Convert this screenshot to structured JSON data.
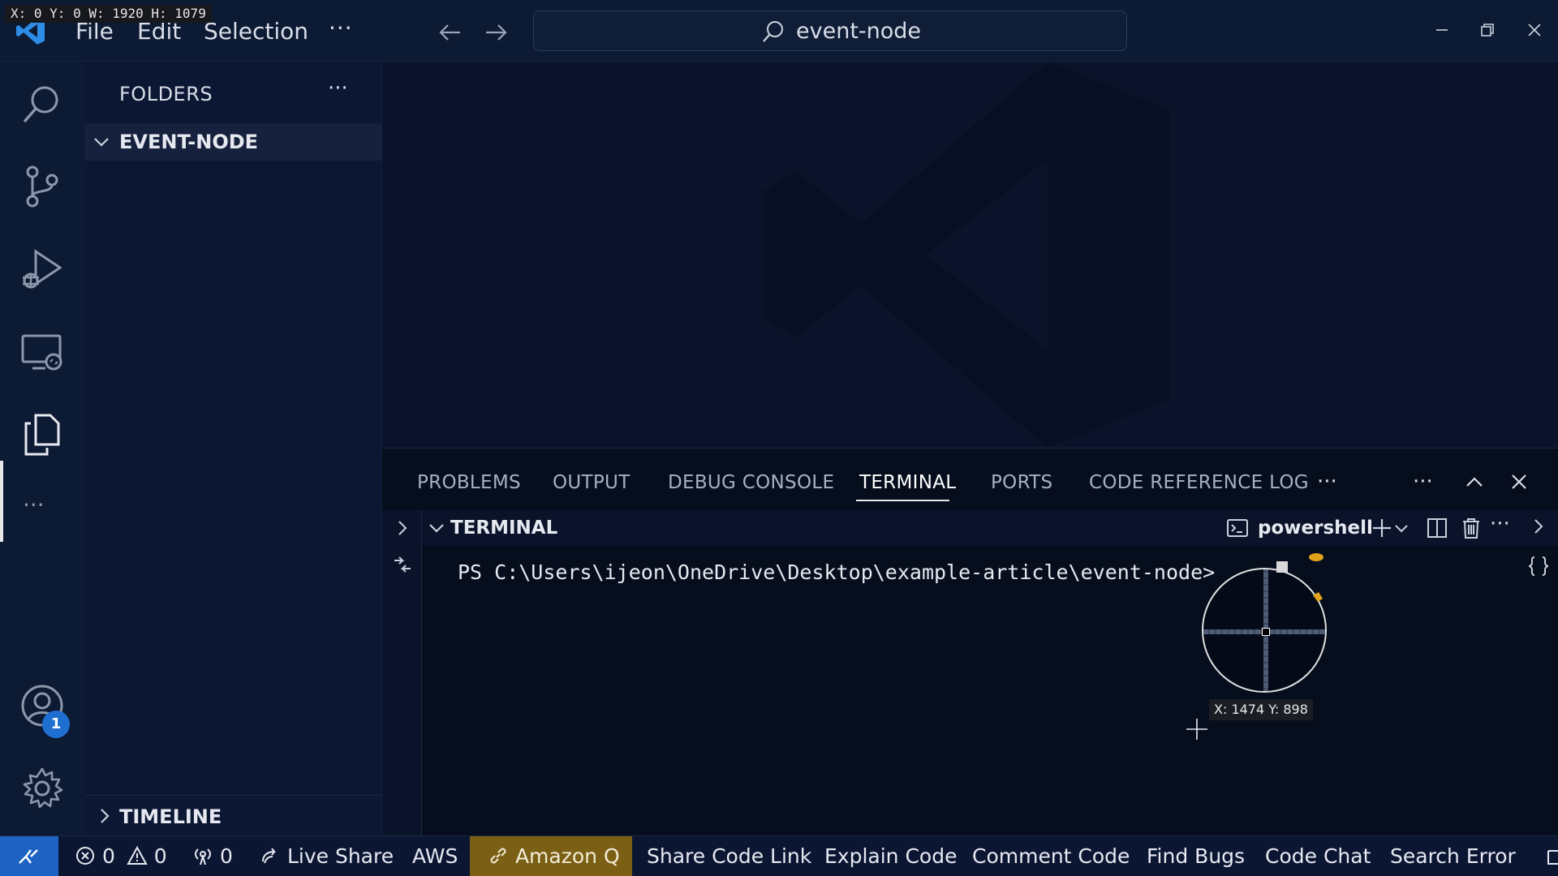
{
  "overlay": {
    "coord_badge": "X: 0 Y: 0 W: 1920 H: 1079",
    "magnifier_readout": "X: 1474 Y: 898"
  },
  "titlebar": {
    "menu": [
      "File",
      "Edit",
      "Selection"
    ],
    "more": "···",
    "command_center": "event-node"
  },
  "activitybar": {
    "icons": [
      "search-icon",
      "source-control-icon",
      "run-debug-icon",
      "remote-explorer-icon",
      "explorer-icon",
      "more-icon",
      "accounts-icon",
      "settings-icon"
    ],
    "more": "···",
    "accounts_badge": "1"
  },
  "sidebar": {
    "title": "FOLDERS",
    "more": "···",
    "folder": "EVENT-NODE",
    "timeline": "TIMELINE"
  },
  "panel": {
    "tabs": [
      "PROBLEMS",
      "OUTPUT",
      "DEBUG CONSOLE",
      "TERMINAL",
      "PORTS",
      "CODE REFERENCE LOG"
    ],
    "active_tab": "TERMINAL",
    "overflow": "···",
    "more": "···",
    "section_title": "TERMINAL",
    "shell": "powershell",
    "prompt_line": "PS C:\\Users\\ijeon\\OneDrive\\Desktop\\example-article\\event-node>"
  },
  "statusbar": {
    "errors": "0",
    "warnings": "0",
    "ports": "0",
    "live_share": "Live Share",
    "aws": "AWS",
    "amazon_q": "Amazon Q",
    "items": [
      "Share Code Link",
      "Explain Code",
      "Comment Code",
      "Find Bugs",
      "Code Chat",
      "Search Error"
    ]
  },
  "colors": {
    "accent_blue": "#1e63c4",
    "amazon_q_bg": "#7a5f14",
    "badge_blue": "#1f6fd1"
  }
}
